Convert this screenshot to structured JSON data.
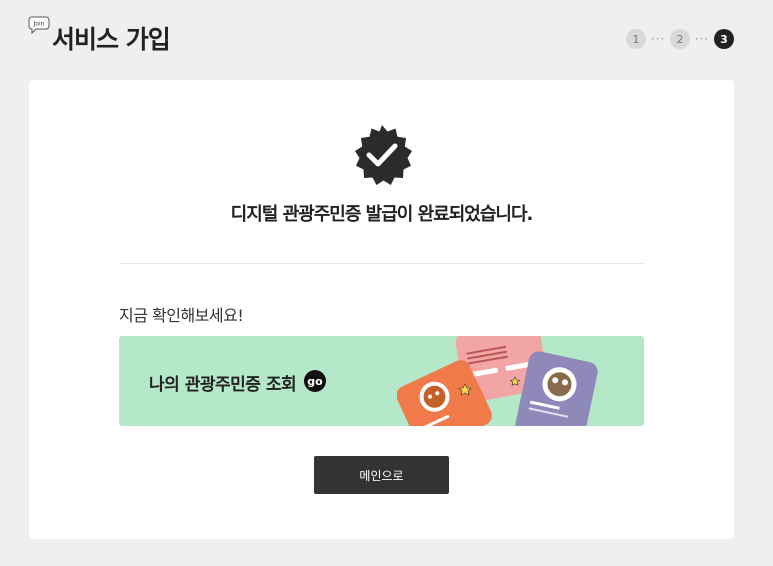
{
  "header": {
    "join_icon_text": "Join",
    "title": "서비스 가입",
    "steps": [
      "1",
      "2",
      "3"
    ],
    "step_separator": "···",
    "current_step": 3
  },
  "card": {
    "done_message": "디지털 관광주민증 발급이 완료되었습니다.",
    "check_now": "지금 확인해보세요!",
    "banner": {
      "label": "나의 관광주민증 조회",
      "go_icon": "go"
    },
    "main_button": "메인으로"
  },
  "icons": {
    "join": "speech-bubble-icon",
    "done": "check-badge-icon",
    "go": "go-icon"
  },
  "colors": {
    "background": "#efefef",
    "card": "#ffffff",
    "banner": "#b5e8c9",
    "dark": "#222222",
    "button": "#333333"
  }
}
